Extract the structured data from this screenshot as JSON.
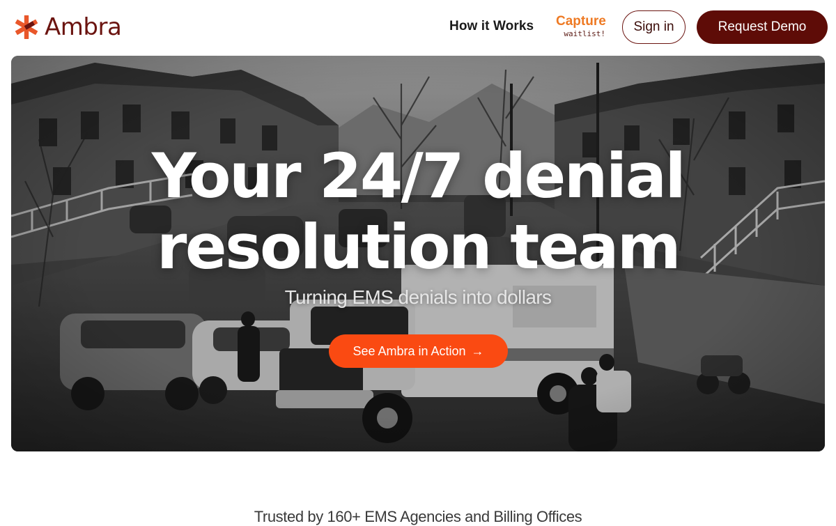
{
  "brand": {
    "name": "Ambra",
    "logo_icon": "asterisk-logo-icon",
    "primary_color": "#5e0c07",
    "accent_color": "#fa4a12",
    "capture_color": "#ee7a24"
  },
  "nav": {
    "how_it_works": "How it Works",
    "capture_title": "Capture",
    "capture_subtitle": "waitlist!",
    "sign_in": "Sign in",
    "request_demo": "Request Demo"
  },
  "hero": {
    "title_line1": "Your 24/7 denial",
    "title_line2": "resolution team",
    "subtitle": "Turning EMS denials into dollars",
    "cta_label": "See Ambra in Action",
    "cta_arrow": "→",
    "background": "black-and-white photo of an ambulance on a residential street"
  },
  "trusted": {
    "text": "Trusted by 160+ EMS Agencies and Billing Offices"
  }
}
